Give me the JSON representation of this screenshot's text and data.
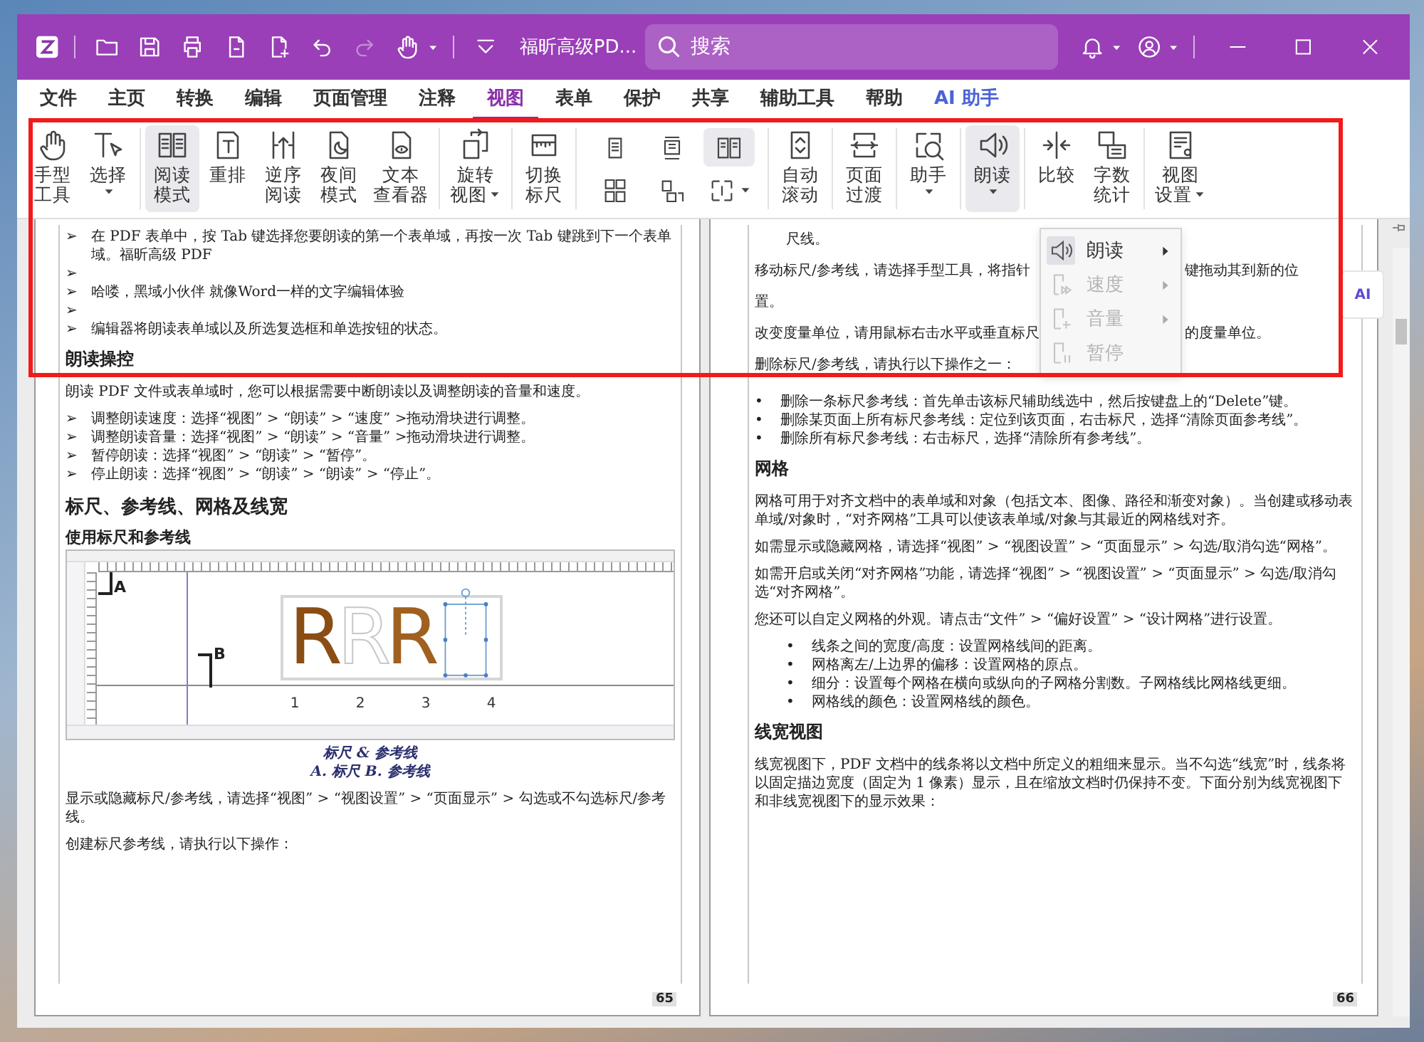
{
  "window": {
    "title": "福昕高级PD...",
    "search": {
      "placeholder": "搜索"
    },
    "quick_tools": [
      {
        "disabled": false
      },
      {
        "disabled": false
      },
      {
        "disabled": false
      },
      {
        "disabled": false
      },
      {
        "disabled": false
      },
      {
        "disabled": false
      },
      {
        "disabled": true
      },
      {
        "disabled": false
      }
    ]
  },
  "menu_tabs": [
    {
      "label": "文件",
      "selected": false,
      "kind": "plain"
    },
    {
      "label": "主页",
      "selected": false,
      "kind": "plain"
    },
    {
      "label": "转换",
      "selected": false,
      "kind": "plain"
    },
    {
      "label": "编辑",
      "selected": false,
      "kind": "plain"
    },
    {
      "label": "页面管理",
      "selected": false,
      "kind": "plain"
    },
    {
      "label": "注释",
      "selected": false,
      "kind": "plain"
    },
    {
      "label": "视图",
      "selected": true,
      "kind": "plain"
    },
    {
      "label": "表单",
      "selected": false,
      "kind": "plain"
    },
    {
      "label": "保护",
      "selected": false,
      "kind": "plain"
    },
    {
      "label": "共享",
      "selected": false,
      "kind": "plain"
    },
    {
      "label": "辅助工具",
      "selected": false,
      "kind": "plain"
    },
    {
      "label": "帮助",
      "selected": false,
      "kind": "plain"
    },
    {
      "label": "AI 助手",
      "selected": false,
      "kind": "ai"
    }
  ],
  "ribbon": {
    "groups": [
      {
        "items": [
          {
            "kind": "large",
            "label": [
              "手型",
              "工具"
            ],
            "selected": false,
            "has_menu": false
          },
          {
            "kind": "large",
            "label": [
              "选择"
            ],
            "selected": false,
            "has_menu": true
          }
        ]
      },
      {
        "items": [
          {
            "kind": "large",
            "label": [
              "阅读",
              "模式"
            ],
            "selected": true,
            "has_menu": false
          },
          {
            "kind": "large",
            "label": [
              "重排"
            ],
            "selected": false,
            "has_menu": false
          },
          {
            "kind": "large",
            "label": [
              "逆序",
              "阅读"
            ],
            "selected": false,
            "has_menu": false
          },
          {
            "kind": "large",
            "label": [
              "夜间",
              "模式"
            ],
            "selected": false,
            "has_menu": false
          },
          {
            "kind": "large",
            "label": [
              "文本",
              "查看器"
            ],
            "selected": false,
            "has_menu": false
          }
        ]
      },
      {
        "items": [
          {
            "kind": "large",
            "label": [
              "旋转",
              "视图"
            ],
            "selected": false,
            "has_menu": true
          }
        ]
      },
      {
        "items": [
          {
            "kind": "large",
            "label": [
              "切换",
              "标尺"
            ],
            "selected": false,
            "has_menu": false
          }
        ]
      },
      {
        "items": [
          {
            "kind": "small",
            "selected": false,
            "has_menu": false
          },
          {
            "kind": "small",
            "selected": false,
            "has_menu": false
          },
          {
            "kind": "small",
            "selected": true,
            "has_menu": false
          },
          {
            "kind": "small",
            "selected": false,
            "has_menu": false
          },
          {
            "kind": "small",
            "selected": false,
            "has_menu": false
          },
          {
            "kind": "small",
            "selected": false,
            "has_menu": true
          }
        ]
      },
      {
        "items": [
          {
            "kind": "large",
            "label": [
              "自动",
              "滚动"
            ],
            "selected": false,
            "has_menu": false
          }
        ]
      },
      {
        "items": [
          {
            "kind": "large",
            "label": [
              "页面",
              "过渡"
            ],
            "selected": false,
            "has_menu": false
          }
        ]
      },
      {
        "items": [
          {
            "kind": "large",
            "label": [
              "助手"
            ],
            "selected": false,
            "has_menu": true
          }
        ]
      },
      {
        "items": [
          {
            "kind": "large",
            "label": [
              "朗读"
            ],
            "selected": true,
            "has_menu": true
          }
        ]
      },
      {
        "items": [
          {
            "kind": "large",
            "label": [
              "比较"
            ],
            "selected": false,
            "has_menu": false
          },
          {
            "kind": "large",
            "label": [
              "字数",
              "统计"
            ],
            "selected": false,
            "has_menu": false
          }
        ]
      },
      {
        "items": [
          {
            "kind": "large",
            "label": [
              "视图",
              "设置"
            ],
            "selected": false,
            "has_menu": true
          }
        ]
      }
    ]
  },
  "read_aloud_menu": {
    "items": [
      {
        "label": "朗读",
        "selected": true,
        "disabled": false,
        "has_submenu": true
      },
      {
        "label": "速度",
        "selected": false,
        "disabled": true,
        "has_submenu": true
      },
      {
        "label": "音量",
        "selected": false,
        "disabled": true,
        "has_submenu": true
      },
      {
        "label": "暂停",
        "selected": false,
        "disabled": true,
        "has_submenu": false
      }
    ]
  },
  "pages": [
    {
      "blocks": [
        {
          "kind": "bullet",
          "marker": "➢",
          "text": "在 PDF 表单中，按 Tab 键选择您要朗读的第一个表单域，再按一次 Tab 键跳到下一个表单域。福昕高级 PDF"
        },
        {
          "kind": "bullet",
          "marker": "➢"
        },
        {
          "kind": "bullet",
          "marker": "➢",
          "text": "哈喽，黑域小伙伴 就像Word一样的文字编辑体验"
        },
        {
          "kind": "bullet",
          "marker": "➢"
        },
        {
          "kind": "bullet",
          "marker": "➢",
          "text": "编辑器将朗读表单域以及所选复选框和单选按钮的状态。"
        },
        {
          "kind": "heading",
          "text": "朗读操控"
        },
        {
          "kind": "para",
          "text": "朗读 PDF 文件或表单域时，您可以根据需要中断朗读以及调整朗读的音量和速度。"
        },
        {
          "kind": "bullet",
          "marker": "➢",
          "text": "调整朗读速度：选择“视图” > “朗读” > “速度” >拖动滑块进行调整。"
        },
        {
          "kind": "bullet",
          "marker": "➢",
          "text": "调整朗读音量：选择“视图” > “朗读” > “音量” >拖动滑块进行调整。"
        },
        {
          "kind": "bullet",
          "marker": "➢",
          "text": "暂停朗读：选择“视图” > “朗读” > “暂停”。"
        },
        {
          "kind": "bullet",
          "marker": "➢",
          "text": "停止朗读：选择“视图” > “朗读” > “朗读” > “停止”。"
        },
        {
          "kind": "title",
          "text": "标尺、参考线、网格及线宽"
        },
        {
          "kind": "subheading",
          "text": "使用标尺和参考线"
        },
        {
          "kind": "figure",
          "labels": [
            "A",
            "B"
          ],
          "letters": [
            "R",
            "R",
            "R"
          ],
          "ticks": [
            "1",
            "2",
            "3",
            "4"
          ]
        },
        {
          "kind": "caption",
          "lines": [
            "标尺 & 参考线",
            "A. 标尺   B. 参考线"
          ]
        },
        {
          "kind": "para",
          "text": "显示或隐藏标尺/参考线，请选择“视图” > “视图设置” > “页面显示” > 勾选或不勾选标尺/参考线。"
        },
        {
          "kind": "para",
          "text": "创建标尺参考线，请执行以下操作："
        }
      ],
      "page_number": "65"
    },
    {
      "top_rows": [
        {
          "kind": "indent",
          "text": "尺线。"
        },
        {
          "kind": "split",
          "left": "移动标尺/参考线，请选择手型工具，将指针",
          "right": "键拖动其到新的位"
        },
        {
          "kind": "plain",
          "text": "置。"
        },
        {
          "kind": "split",
          "left": "改变度量单位，请用鼠标右击水平或垂直标尺",
          "right": "的度量单位。"
        },
        {
          "kind": "plain",
          "text": "删除标尺/参考线，请执行以下操作之一："
        }
      ],
      "blocks": [
        {
          "kind": "bullet",
          "marker": "•",
          "text": "删除一条标尺参考线：首先单击该标尺辅助线选中，然后按键盘上的“Delete”键。"
        },
        {
          "kind": "bullet",
          "marker": "•",
          "text": "删除某页面上所有标尺参考线：定位到该页面，右击标尺，选择“清除页面参考线”。"
        },
        {
          "kind": "bullet",
          "marker": "•",
          "text": "删除所有标尺参考线：右击标尺，选择“清除所有参考线”。"
        },
        {
          "kind": "heading",
          "text": "网格"
        },
        {
          "kind": "para",
          "text": "网格可用于对齐文档中的表单域和对象（包括文本、图像、路径和渐变对象）。当创建或移动表单域/对象时，“对齐网格”工具可以使该表单域/对象与其最近的网格线对齐。"
        },
        {
          "kind": "para",
          "text": "如需显示或隐藏网格，请选择“视图” > “视图设置” > “页面显示” > 勾选/取消勾选“网格”。"
        },
        {
          "kind": "para",
          "text": "如需开启或关闭“对齐网格”功能，请选择“视图” > “视图设置” > “页面显示” > 勾选/取消勾选“对齐网格”。"
        },
        {
          "kind": "para",
          "text": "您还可以自定义网格的外观。请点击“文件” > “偏好设置” > “设计网格”进行设置。"
        },
        {
          "kind": "subbullet",
          "marker": "•",
          "text": "线条之间的宽度/高度：设置网格线间的距离。"
        },
        {
          "kind": "subbullet",
          "marker": "•",
          "text": "网格离左/上边界的偏移：设置网格的原点。"
        },
        {
          "kind": "subbullet",
          "marker": "•",
          "text": "细分：设置每个网格在横向或纵向的子网格分割数。子网格线比网格线更细。"
        },
        {
          "kind": "subbullet",
          "marker": "•",
          "text": "网格线的颜色：设置网格线的颜色。"
        },
        {
          "kind": "heading",
          "text": "线宽视图"
        },
        {
          "kind": "para",
          "text": "线宽视图下，PDF 文档中的线条将以文档中所定义的粗细来显示。当不勾选“线宽”时，线条将以固定描边宽度（固定为 1 像素）显示，且在缩放文档时仍保持不变。下面分别为线宽视图下和非线宽视图下的显示效果："
        }
      ],
      "page_number": "66"
    }
  ],
  "ai_float": {
    "label": "AI"
  }
}
